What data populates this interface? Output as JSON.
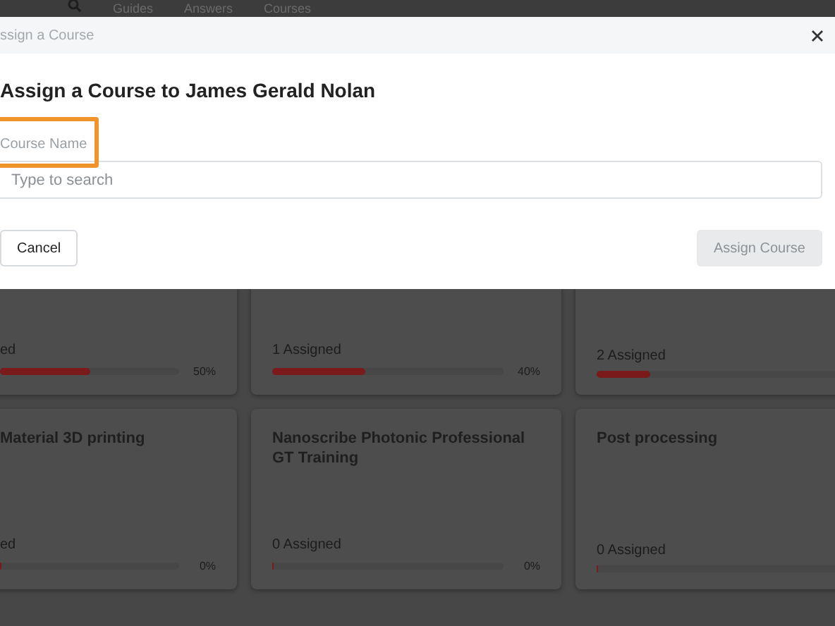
{
  "nav": {
    "items": [
      "Guides",
      "Answers",
      "Courses"
    ]
  },
  "modal": {
    "header_title": "ssign a Course",
    "heading": "Assign a Course to James Gerald Nolan",
    "field": {
      "label": "Course Name",
      "placeholder": "Type to search",
      "highlighted": true
    },
    "cancel": "Cancel",
    "assign": {
      "label": "Assign Course",
      "disabled": true
    }
  },
  "cards": [
    {
      "assigned": "ed",
      "level": 0.5,
      "percent": "50%"
    },
    {
      "assigned": "1 Assigned",
      "level": 0.4,
      "percent": "40%"
    },
    {
      "assigned": "2 Assigned",
      "level": 0.2
    },
    {
      "title": "Material 3D printing",
      "assigned": "ed",
      "level": 0,
      "percent": "0%"
    },
    {
      "title": "Nanoscribe Photonic Professional GT Training",
      "assigned": "0 Assigned",
      "level": 0,
      "percent": "0%"
    },
    {
      "title": "Post processing",
      "assigned": "0 Assigned",
      "level": 0
    }
  ]
}
